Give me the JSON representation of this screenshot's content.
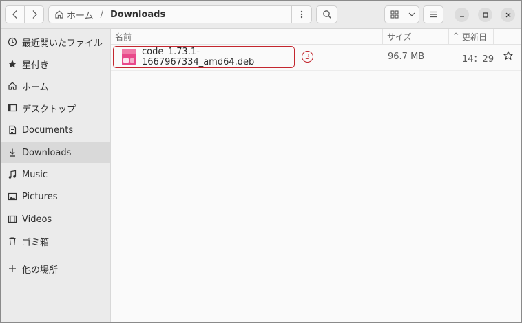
{
  "path": {
    "home": "ホーム",
    "separator": "/",
    "current": "Downloads"
  },
  "sidebar": {
    "items": [
      {
        "label": "最近開いたファイル",
        "icon": "recent-icon"
      },
      {
        "label": "星付き",
        "icon": "star-icon"
      },
      {
        "label": "ホーム",
        "icon": "home-icon"
      },
      {
        "label": "デスクトップ",
        "icon": "desktop-icon"
      },
      {
        "label": "Documents",
        "icon": "document-icon"
      },
      {
        "label": "Downloads",
        "icon": "download-icon",
        "active": true
      },
      {
        "label": "Music",
        "icon": "music-icon"
      },
      {
        "label": "Pictures",
        "icon": "picture-icon"
      },
      {
        "label": "Videos",
        "icon": "video-icon"
      },
      {
        "label": "ゴミ箱",
        "icon": "trash-icon"
      }
    ],
    "other_locations": {
      "label": "他の場所",
      "icon": "plus-icon"
    }
  },
  "columns": {
    "name": "名前",
    "size": "サイズ",
    "modified": "更新日",
    "sort_indicator": "^"
  },
  "files": [
    {
      "name": "code_1.73.1-1667967334_amd64.deb",
      "size": "96.7 MB",
      "modified": "14：29",
      "step": "3",
      "icon": "deb-package-icon"
    }
  ],
  "colors": {
    "highlight": "#c3262e",
    "accent_pink": "#e8488a"
  }
}
